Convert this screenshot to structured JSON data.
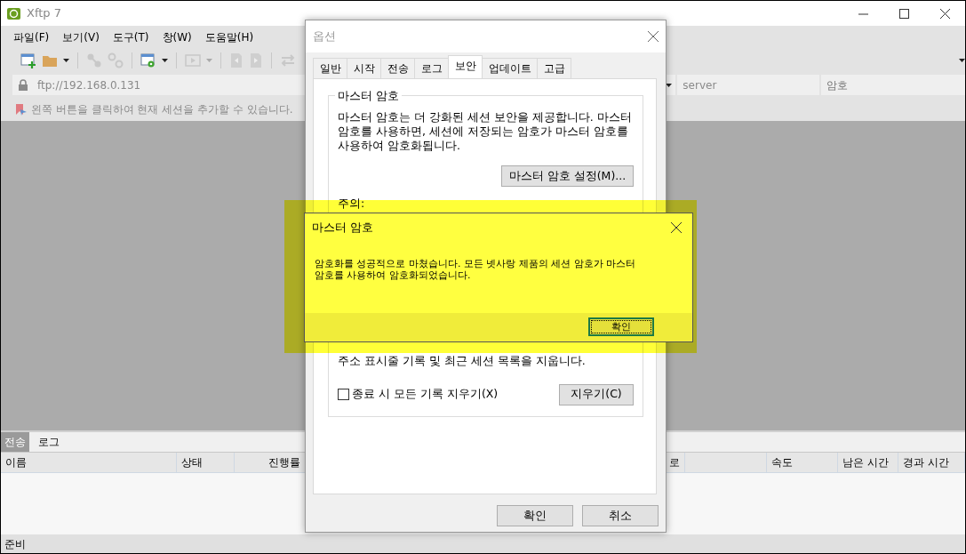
{
  "window": {
    "title": "Xftp 7"
  },
  "menu": [
    "파일(F)",
    "보기(V)",
    "도구(T)",
    "창(W)",
    "도움말(H)"
  ],
  "address_bar": {
    "value": "ftp://192.168.0.131",
    "user": "server",
    "password_placeholder": "암호"
  },
  "hint": "왼쪽 버튼을 클릭하여 현재 세션을 추가할 수 있습니다.",
  "bottom_tabs": [
    {
      "label": "전송",
      "selected": true
    },
    {
      "label": "로그",
      "selected": false
    }
  ],
  "columns": [
    "이름",
    "상태",
    "진행률",
    "로",
    "속도",
    "남은 시간",
    "경과 시간"
  ],
  "status_bar": "준비",
  "options_dialog": {
    "title": "옵션",
    "tabs": [
      {
        "label": "일반",
        "selected": false
      },
      {
        "label": "시작",
        "selected": false
      },
      {
        "label": "전송",
        "selected": false
      },
      {
        "label": "로그",
        "selected": false
      },
      {
        "label": "보안",
        "selected": true
      },
      {
        "label": "업데이트",
        "selected": false
      },
      {
        "label": "고급",
        "selected": false
      }
    ],
    "group_title": "마스터 암호",
    "description": "마스터 암호는 더 강화된 세션 보안을 제공합니다. 마스터 암호를 사용하면, 세션에 저장되는 암호가 마스터 암호를 사용하여 암호화됩니다.",
    "set_button": "마스터 암호 설정(M)...",
    "notice_label": "주의:",
    "clear_text": "주소 표시줄 기록 및 최근 세션 목록을 지웁니다.",
    "clear_checkbox": {
      "label": "종료 시 모든 기록 지우기(X)",
      "checked": false
    },
    "clear_button": "지우기(C)",
    "buttons": [
      "확인",
      "취소"
    ]
  },
  "message_box": {
    "title": "마스터 암호",
    "message": "암호화를 성공적으로 마쳤습니다. 모든 넷사랑 제품의 세션 암호가 마스터 암호를 사용하여 암호화되었습니다.",
    "button": "확인"
  }
}
